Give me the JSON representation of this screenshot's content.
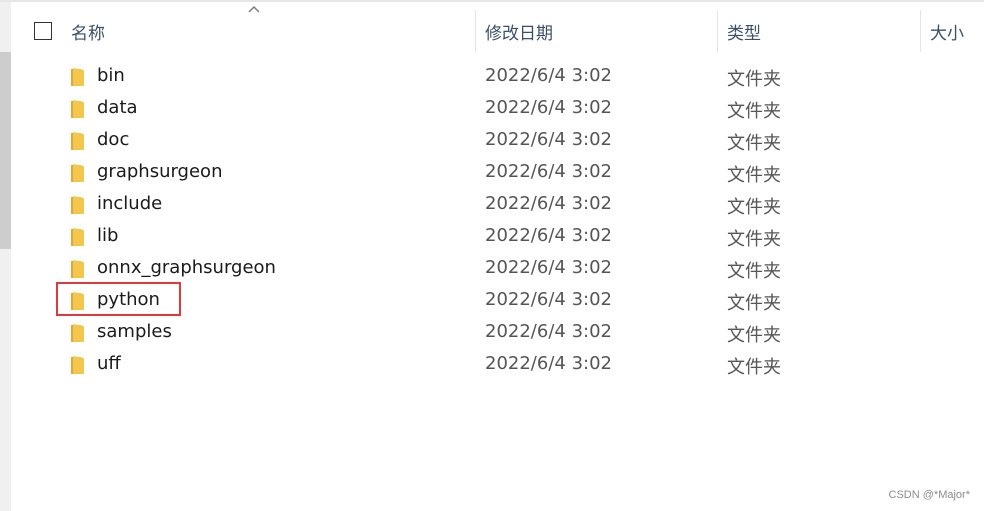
{
  "header": {
    "name": "名称",
    "date_modified": "修改日期",
    "type": "类型",
    "size": "大小"
  },
  "rows": [
    {
      "name": "bin",
      "date": "2022/6/4 3:02",
      "type": "文件夹"
    },
    {
      "name": "data",
      "date": "2022/6/4 3:02",
      "type": "文件夹"
    },
    {
      "name": "doc",
      "date": "2022/6/4 3:02",
      "type": "文件夹"
    },
    {
      "name": "graphsurgeon",
      "date": "2022/6/4 3:02",
      "type": "文件夹"
    },
    {
      "name": "include",
      "date": "2022/6/4 3:02",
      "type": "文件夹"
    },
    {
      "name": "lib",
      "date": "2022/6/4 3:02",
      "type": "文件夹"
    },
    {
      "name": "onnx_graphsurgeon",
      "date": "2022/6/4 3:02",
      "type": "文件夹"
    },
    {
      "name": "python",
      "date": "2022/6/4 3:02",
      "type": "文件夹"
    },
    {
      "name": "samples",
      "date": "2022/6/4 3:02",
      "type": "文件夹"
    },
    {
      "name": "uff",
      "date": "2022/6/4 3:02",
      "type": "文件夹"
    }
  ],
  "watermark": "CSDN @*Major*",
  "colors": {
    "highlight": "#e03a3a",
    "folder": "#f3c64d",
    "header_text": "#3b5068"
  }
}
